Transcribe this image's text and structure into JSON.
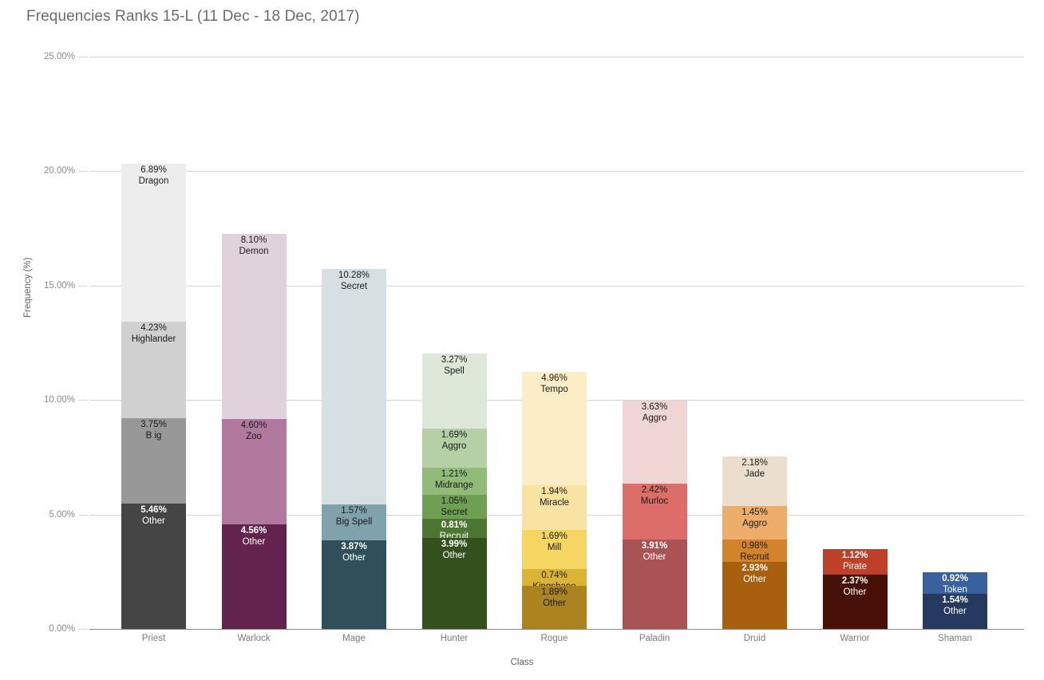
{
  "chart": {
    "title": "Frequencies Ranks 15-L (11 Dec - 18 Dec, 2017)",
    "xlabel": "Class",
    "ylabel": "Frequency (%)"
  },
  "chart_data": {
    "type": "bar",
    "stacked": true,
    "title": "Frequencies Ranks 15-L (11 Dec - 18 Dec, 2017)",
    "xlabel": "Class",
    "ylabel": "Frequency (%)",
    "ylim": [
      0,
      25
    ],
    "ytick_labels": [
      "0.00%",
      "5.00%",
      "10.00%",
      "15.00%",
      "20.00%",
      "25.00%"
    ],
    "ytick_values": [
      0,
      5,
      10,
      15,
      20,
      25
    ],
    "grid": true,
    "legend": "none",
    "categories": [
      "Priest",
      "Warlock",
      "Mage",
      "Hunter",
      "Rogue",
      "Paladin",
      "Druid",
      "Warrior",
      "Shaman"
    ],
    "bars": [
      {
        "category": "Priest",
        "total": 20.33,
        "segments": [
          {
            "name": "Dragon",
            "value": 6.89,
            "label": "6.89%",
            "color": "#ededed",
            "text": "dark"
          },
          {
            "name": "Highlander",
            "value": 4.23,
            "label": "4.23%",
            "color": "#d0d0d0",
            "text": "dark"
          },
          {
            "name": "B ig",
            "value": 3.75,
            "label": "3.75%",
            "color": "#989898",
            "text": "dark"
          },
          {
            "name": "Other",
            "value": 5.46,
            "label": "5.46%",
            "color": "#454545",
            "text": "light"
          }
        ]
      },
      {
        "category": "Warlock",
        "total": 17.26,
        "segments": [
          {
            "name": "Demon",
            "value": 8.1,
            "label": "8.10%",
            "color": "#e0d2dd",
            "text": "dark"
          },
          {
            "name": "Zoo",
            "value": 4.6,
            "label": "4.60%",
            "color": "#b1799e",
            "text": "dark"
          },
          {
            "name": "Other",
            "value": 4.56,
            "label": "4.56%",
            "color": "#62234d",
            "text": "light"
          }
        ]
      },
      {
        "category": "Mage",
        "total": 15.72,
        "segments": [
          {
            "name": "Secret",
            "value": 10.28,
            "label": "10.28%",
            "color": "#d6e0e2",
            "text": "dark"
          },
          {
            "name": "Big Spell",
            "value": 1.57,
            "label": "1.57%",
            "color": "#80a2ab",
            "text": "dark"
          },
          {
            "name": "Other",
            "value": 3.87,
            "label": "3.87%",
            "color": "#2f4f5b",
            "text": "light"
          }
        ]
      },
      {
        "category": "Hunter",
        "total": 12.02,
        "segments": [
          {
            "name": "Spell",
            "value": 3.27,
            "label": "3.27%",
            "color": "#dde8d8",
            "text": "dark"
          },
          {
            "name": "Aggro",
            "value": 1.69,
            "label": "1.69%",
            "color": "#b4d0a4",
            "text": "dark"
          },
          {
            "name": "Midrange",
            "value": 1.21,
            "label": "1.21%",
            "color": "#90bb79",
            "text": "dark"
          },
          {
            "name": "Secret",
            "value": 1.05,
            "label": "1.05%",
            "color": "#6e9f52",
            "text": "dark"
          },
          {
            "name": "Recruit",
            "value": 0.81,
            "label": "0.81%",
            "color": "#4c7632",
            "text": "light"
          },
          {
            "name": "Other",
            "value": 3.99,
            "label": "3.99%",
            "color": "#33501d",
            "text": "light"
          }
        ]
      },
      {
        "category": "Rogue",
        "total": 11.22,
        "segments": [
          {
            "name": "Tempo",
            "value": 4.96,
            "label": "4.96%",
            "color": "#fbeec6",
            "text": "dark"
          },
          {
            "name": "Miracle",
            "value": 1.94,
            "label": "1.94%",
            "color": "#f8e3a2",
            "text": "dark"
          },
          {
            "name": "Mill",
            "value": 1.69,
            "label": "1.69%",
            "color": "#f5d663",
            "text": "dark"
          },
          {
            "name": "Kingsbane",
            "value": 0.74,
            "label": "0.74%",
            "color": "#dbb435",
            "text": "dark"
          },
          {
            "name": "Other",
            "value": 1.89,
            "label": "1.89%",
            "color": "#ab8420",
            "text": "dark"
          }
        ]
      },
      {
        "category": "Paladin",
        "total": 9.96,
        "segments": [
          {
            "name": "Aggro",
            "value": 3.63,
            "label": "3.63%",
            "color": "#efd6d4",
            "text": "dark"
          },
          {
            "name": "Murloc",
            "value": 2.42,
            "label": "2.42%",
            "color": "#dd6d68",
            "text": "dark"
          },
          {
            "name": "Other",
            "value": 3.91,
            "label": "3.91%",
            "color": "#aa5355",
            "text": "light"
          }
        ]
      },
      {
        "category": "Druid",
        "total": 7.54,
        "segments": [
          {
            "name": "Jade",
            "value": 2.18,
            "label": "2.18%",
            "color": "#ebdecd",
            "text": "dark"
          },
          {
            "name": "Aggro",
            "value": 1.45,
            "label": "1.45%",
            "color": "#eeae6b",
            "text": "dark"
          },
          {
            "name": "Recruit",
            "value": 0.98,
            "label": "0.98%",
            "color": "#d3842b",
            "text": "dark"
          },
          {
            "name": "Other",
            "value": 2.93,
            "label": "2.93%",
            "color": "#a8600f",
            "text": "light"
          }
        ]
      },
      {
        "category": "Warrior",
        "total": 3.49,
        "segments": [
          {
            "name": "Pirate",
            "value": 1.12,
            "label": "1.12%",
            "color": "#bf4028",
            "text": "light"
          },
          {
            "name": "Other",
            "value": 2.37,
            "label": "2.37%",
            "color": "#461007",
            "text": "light"
          }
        ]
      },
      {
        "category": "Shaman",
        "total": 2.46,
        "segments": [
          {
            "name": "Token",
            "value": 0.92,
            "label": "0.92%",
            "color": "#39619e",
            "text": "light"
          },
          {
            "name": "Other",
            "value": 1.54,
            "label": "1.54%",
            "color": "#26395e",
            "text": "light"
          }
        ]
      }
    ]
  }
}
